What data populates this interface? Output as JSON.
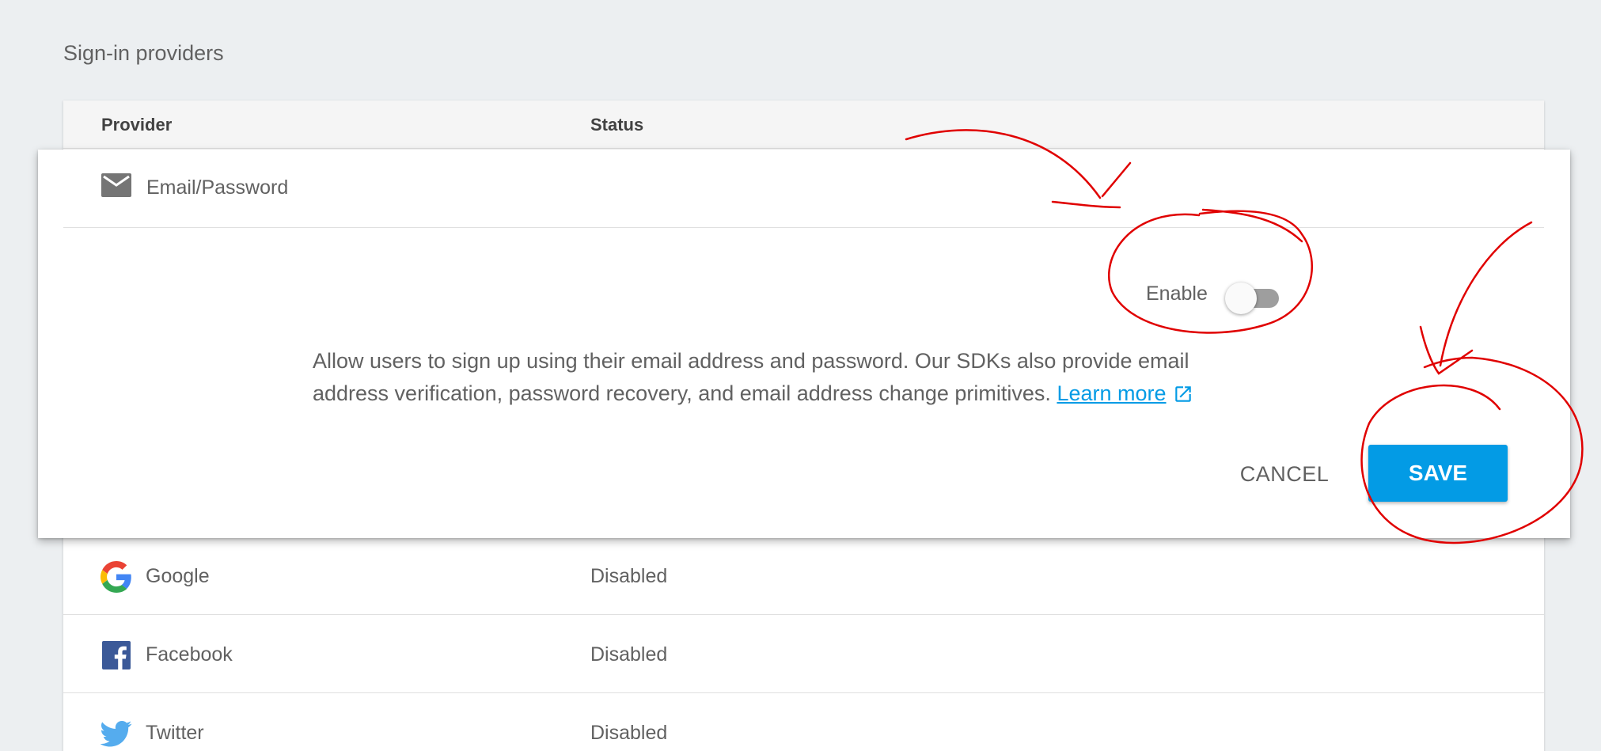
{
  "section_title": "Sign-in providers",
  "table": {
    "columns": [
      "Provider",
      "Status"
    ]
  },
  "expanded": {
    "provider": "Email/Password",
    "icon": "mail-icon",
    "enable_label": "Enable",
    "enabled": false,
    "description": "Allow users to sign up using their email address and password. Our SDKs also provide email address verification, password recovery, and email address change primitives.",
    "learn_more": "Learn more",
    "cancel_label": "CANCEL",
    "save_label": "SAVE"
  },
  "providers": [
    {
      "name": "Google",
      "status": "Disabled",
      "icon": "google-icon"
    },
    {
      "name": "Facebook",
      "status": "Disabled",
      "icon": "facebook-icon"
    },
    {
      "name": "Twitter",
      "status": "Disabled",
      "icon": "twitter-icon"
    }
  ],
  "colors": {
    "accent": "#039be5",
    "annotation": "#e00000",
    "background": "#eceff1"
  }
}
